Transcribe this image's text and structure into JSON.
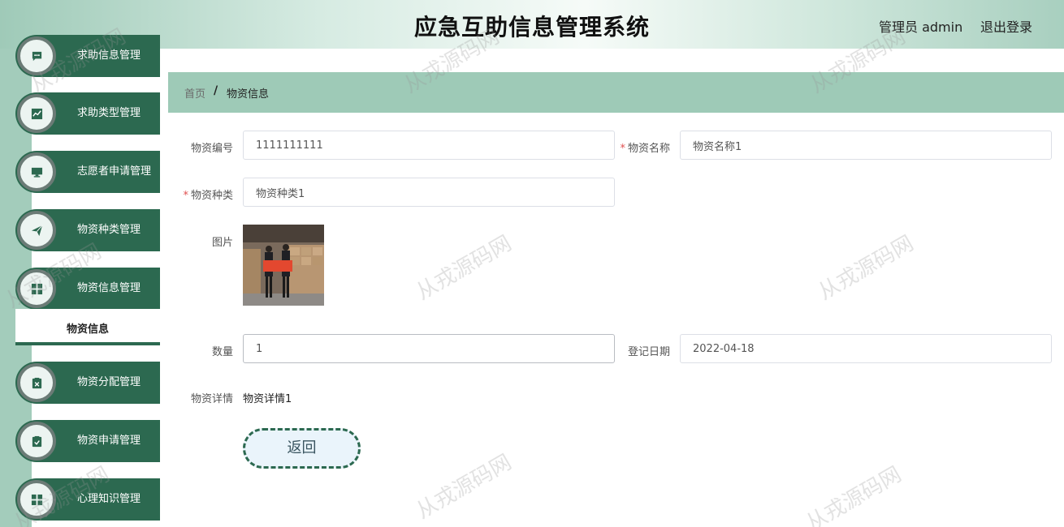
{
  "header": {
    "title": "应急互助信息管理系统",
    "user": "管理员 admin",
    "logout": "退出登录"
  },
  "sidebar": {
    "items": [
      {
        "label": "求助信息管理",
        "icon": "chat-icon"
      },
      {
        "label": "求助类型管理",
        "icon": "chart-icon"
      },
      {
        "label": "志愿者申请管理",
        "icon": "monitor-icon"
      },
      {
        "label": "物资种类管理",
        "icon": "send-icon"
      },
      {
        "label": "物资信息管理",
        "icon": "grid-icon"
      },
      {
        "label": "物资分配管理",
        "icon": "clipboard-x-icon"
      },
      {
        "label": "物资申请管理",
        "icon": "clipboard-check-icon"
      },
      {
        "label": "心理知识管理",
        "icon": "grid-icon"
      }
    ],
    "submenu": {
      "label": "物资信息"
    }
  },
  "breadcrumb": {
    "home": "首页",
    "separator": "/",
    "current": "物资信息"
  },
  "form": {
    "code": {
      "label": "物资编号",
      "value": "1111111111"
    },
    "name": {
      "label": "物资名称",
      "value": "物资名称1"
    },
    "category": {
      "label": "物资种类",
      "value": "物资种类1"
    },
    "picture": {
      "label": "图片"
    },
    "quantity": {
      "label": "数量",
      "value": "1"
    },
    "date": {
      "label": "登记日期",
      "value": "2022-04-18"
    },
    "detail": {
      "label": "物资详情",
      "value": "物资详情1"
    },
    "required_mark": "*"
  },
  "back_button": "返回",
  "watermark": "从戎源码网",
  "colors": {
    "primary": "#2c6950",
    "sidebar_bg": "#a3ccbb",
    "breadcrumb_bg": "#9ecab7",
    "required": "#e05050"
  }
}
